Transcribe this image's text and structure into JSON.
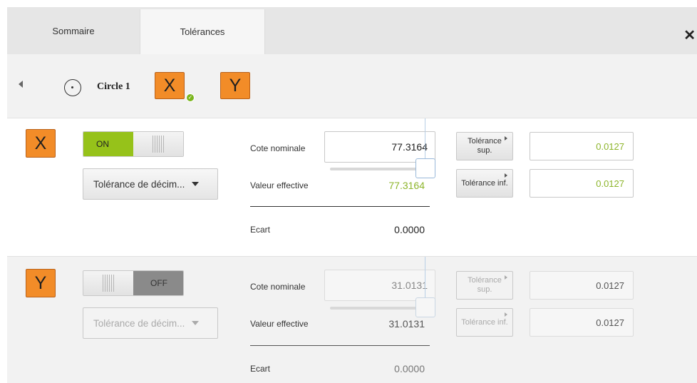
{
  "tabs": {
    "sommaire": "Sommaire",
    "tolerances": "Tolérances",
    "close": "✕"
  },
  "feature": {
    "name": "Circle 1",
    "axis_x": "X",
    "axis_y": "Y"
  },
  "colors": {
    "accent_orange": "#f28c28",
    "on_green": "#96c21a",
    "value_green": "#8db52b"
  },
  "icons": {
    "back": "back-arrow-icon",
    "circle": "circle-feature-icon",
    "check": "check-badge-icon",
    "close": "close-icon"
  },
  "x_row": {
    "axis": "X",
    "toggle": {
      "state": "ON",
      "label": "ON"
    },
    "dropdown": "Tolérance de décim...",
    "cote_nominale_label": "Cote nominale",
    "cote_nominale_value": "77.3164",
    "valeur_effective_label": "Valeur effective",
    "valeur_effective_value": "77.3164",
    "ecart_label": "Ecart",
    "ecart_value": "0.0000",
    "tol_sup_label": "Tolérance sup.",
    "tol_sup_value": "0.0127",
    "tol_inf_label": "Tolérance inf.",
    "tol_inf_value": "0.0127"
  },
  "y_row": {
    "axis": "Y",
    "toggle": {
      "state": "OFF",
      "label": "OFF"
    },
    "dropdown": "Tolérance de décim...",
    "cote_nominale_label": "Cote nominale",
    "cote_nominale_value": "31.0131",
    "valeur_effective_label": "Valeur effective",
    "valeur_effective_value": "31.0131",
    "ecart_label": "Ecart",
    "ecart_value": "0.0000",
    "tol_sup_label": "Tolérance sup.",
    "tol_sup_value": "0.0127",
    "tol_inf_label": "Tolérance inf.",
    "tol_inf_value": "0.0127"
  }
}
